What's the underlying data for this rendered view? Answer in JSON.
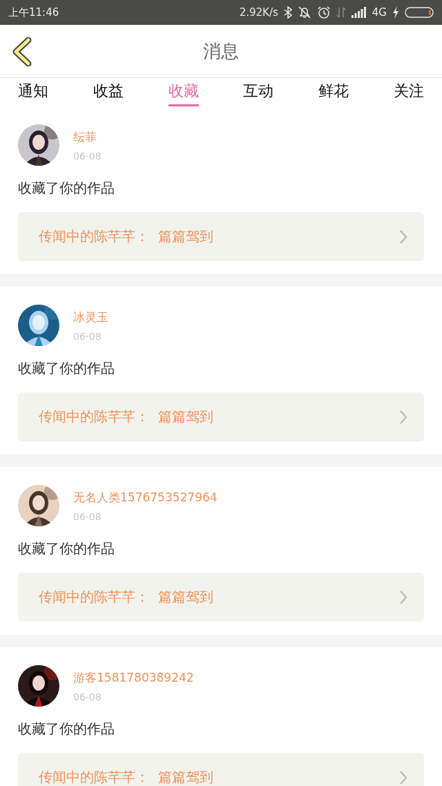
{
  "status_bar": {
    "time": "上午11:46",
    "speed": "2.92K/s",
    "network": "4G"
  },
  "header": {
    "title": "消息"
  },
  "tabs": [
    {
      "label": "通知",
      "selected": false
    },
    {
      "label": "收益",
      "selected": false
    },
    {
      "label": "收藏",
      "selected": true
    },
    {
      "label": "互动",
      "selected": false
    },
    {
      "label": "鲜花",
      "selected": false
    },
    {
      "label": "关注",
      "selected": false
    }
  ],
  "messages": [
    {
      "name": "纭菲",
      "date": "06-08",
      "text": "收藏了你的作品",
      "work": "传闻中的陈芊芊：  篇篇驾到"
    },
    {
      "name": "冰灵玉",
      "date": "06-08",
      "text": "收藏了你的作品",
      "work": "传闻中的陈芊芊：  篇篇驾到"
    },
    {
      "name": "无名人类1576753527964",
      "date": "06-08",
      "text": "收藏了你的作品",
      "work": "传闻中的陈芊芊：  篇篇驾到"
    },
    {
      "name": "游客1581780389242",
      "date": "06-08",
      "text": "收藏了你的作品",
      "work": "传闻中的陈芊芊：  篇篇驾到"
    }
  ]
}
